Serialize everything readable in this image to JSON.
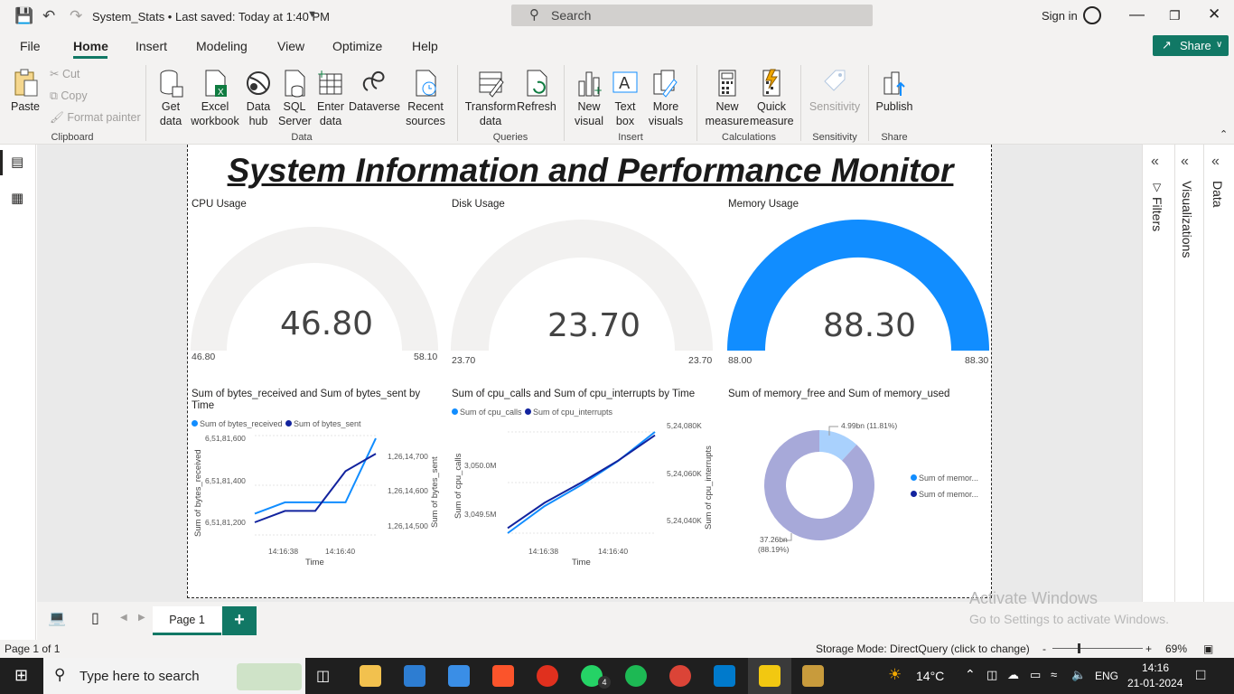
{
  "titlebar": {
    "doc_title": "System_Stats • Last saved: Today at 1:40 PM",
    "search_placeholder": "Search",
    "sign_in": "Sign in"
  },
  "menu": {
    "items": [
      "File",
      "Home",
      "Insert",
      "Modeling",
      "View",
      "Optimize",
      "Help"
    ],
    "active": "Home",
    "share_label": "Share"
  },
  "ribbon": {
    "clipboard": {
      "paste": "Paste",
      "cut": "Cut",
      "copy": "Copy",
      "format_painter": "Format painter",
      "group": "Clipboard"
    },
    "data": {
      "get_data": "Get data",
      "excel": "Excel workbook",
      "data_hub": "Data hub",
      "sql": "SQL Server",
      "enter_data": "Enter data",
      "dataverse": "Dataverse",
      "recent": "Recent sources",
      "group": "Data"
    },
    "queries": {
      "transform": "Transform data",
      "refresh": "Refresh",
      "group": "Queries"
    },
    "insert": {
      "new_visual": "New visual",
      "text_box": "Text box",
      "more_visuals": "More visuals",
      "group": "Insert"
    },
    "calculations": {
      "new_measure": "New measure",
      "quick_measure": "Quick measure",
      "group": "Calculations"
    },
    "sensitivity": {
      "label": "Sensitivity",
      "group": "Sensitivity"
    },
    "share": {
      "publish": "Publish",
      "group": "Share"
    }
  },
  "report": {
    "title": "System Information and Performance Monitor",
    "gauges": [
      {
        "title": "CPU Usage",
        "value": "46.80",
        "min": "46.80",
        "max": "58.10",
        "fill_fraction": 0.0
      },
      {
        "title": "Disk Usage",
        "value": "23.70",
        "min": "23.70",
        "max": "23.70",
        "fill_fraction": 0.0
      },
      {
        "title": "Memory Usage",
        "value": "88.30",
        "min": "88.00",
        "max": "88.30",
        "fill_fraction": 1.0
      }
    ],
    "line1": {
      "title": "Sum of bytes_received and Sum of bytes_sent by Time",
      "legend": [
        "Sum of bytes_received",
        "Sum of bytes_sent"
      ],
      "y_left_title": "Sum of bytes_received",
      "y_left_ticks": [
        "6,51,81,600",
        "6,51,81,400",
        "6,51,81,200"
      ],
      "y_right_title": "Sum of bytes_sent",
      "y_right_ticks": [
        "1,26,14,700",
        "1,26,14,600",
        "1,26,14,500"
      ],
      "x_ticks": [
        "14:16:38",
        "14:16:40"
      ],
      "x_title": "Time"
    },
    "line2": {
      "title": "Sum of cpu_calls and Sum of cpu_interrupts by Time",
      "legend": [
        "Sum of cpu_calls",
        "Sum of cpu_interrupts"
      ],
      "y_left_title": "Sum of cpu_calls",
      "y_left_ticks": [
        "3,050.0M",
        "3,049.5M"
      ],
      "y_right_title": "Sum of cpu_interrupts",
      "y_right_ticks": [
        "5,24,080K",
        "5,24,060K",
        "5,24,040K"
      ],
      "x_ticks": [
        "14:16:38",
        "14:16:40"
      ],
      "x_title": "Time"
    },
    "donut": {
      "title": "Sum of memory_free and Sum of memory_used",
      "label_free": "4.99bn (11.81%)",
      "label_used_1": "37.26bn",
      "label_used_2": "(88.19%)",
      "legend": [
        "Sum of memor...",
        "Sum of memor..."
      ]
    }
  },
  "chart_data": [
    {
      "type": "line",
      "title": "Sum of bytes_received and Sum of bytes_sent by Time",
      "xlabel": "Time",
      "x": [
        "14:16:37",
        "14:16:38",
        "14:16:39",
        "14:16:40",
        "14:16:41"
      ],
      "series": [
        {
          "name": "Sum of bytes_received",
          "axis": "left",
          "values": [
            6518115,
            6518123,
            6518123,
            6518123,
            6518168
          ]
        },
        {
          "name": "Sum of bytes_sent",
          "axis": "right",
          "values": [
            126144770,
            126145100,
            126145100,
            126146260,
            126146770
          ]
        }
      ],
      "ylabel_left": "Sum of bytes_received",
      "ylabel_right": "Sum of bytes_sent",
      "ylim_left": [
        6518100,
        6518170
      ],
      "ylim_right": [
        126144400,
        126147300
      ]
    },
    {
      "type": "line",
      "title": "Sum of cpu_calls and Sum of cpu_interrupts by Time",
      "xlabel": "Time",
      "x": [
        "14:16:37",
        "14:16:38",
        "14:16:39",
        "14:16:40",
        "14:16:41"
      ],
      "series": [
        {
          "name": "Sum of cpu_calls",
          "axis": "left",
          "values": [
            3049.3,
            3049.58,
            3049.8,
            3050.05,
            3050.35
          ]
        },
        {
          "name": "Sum of cpu_interrupts",
          "axis": "right",
          "values": [
            524033,
            524048,
            524060,
            524073,
            524088
          ]
        }
      ],
      "ylabel_left": "Sum of cpu_calls",
      "ylabel_right": "Sum of cpu_interrupts",
      "ylim_left": [
        3049.3,
        3050.35
      ],
      "ylim_right": [
        524030,
        524090
      ]
    },
    {
      "type": "pie",
      "title": "Sum of memory_free and Sum of memory_used",
      "categories": [
        "Sum of memory_free",
        "Sum of memory_used"
      ],
      "values": [
        4.99,
        37.26
      ],
      "percent": [
        11.81,
        88.19
      ]
    }
  ],
  "colors": {
    "accent": "#117865",
    "series_light": "#118dff",
    "series_dark": "#12239e",
    "gauge_fill": "#118dff",
    "gauge_empty": "#f2f1f0",
    "donut_free": "#a9d1fd",
    "donut_used": "#a7a9d9"
  },
  "panes": {
    "filters": "Filters",
    "visualizations": "Visualizations",
    "data": "Data"
  },
  "tabs": {
    "page1": "Page 1"
  },
  "status": {
    "page": "Page 1 of 1",
    "storage": "Storage Mode: DirectQuery (click to change)",
    "zoom": "69%"
  },
  "watermark": {
    "line1": "Activate Windows",
    "line2": "Go to Settings to activate Windows."
  },
  "taskbar": {
    "search": "Type here to search",
    "weather": "14°C",
    "lang": "ENG",
    "time": "14:16",
    "date": "21-01-2024",
    "whatsapp_badge": "4"
  }
}
